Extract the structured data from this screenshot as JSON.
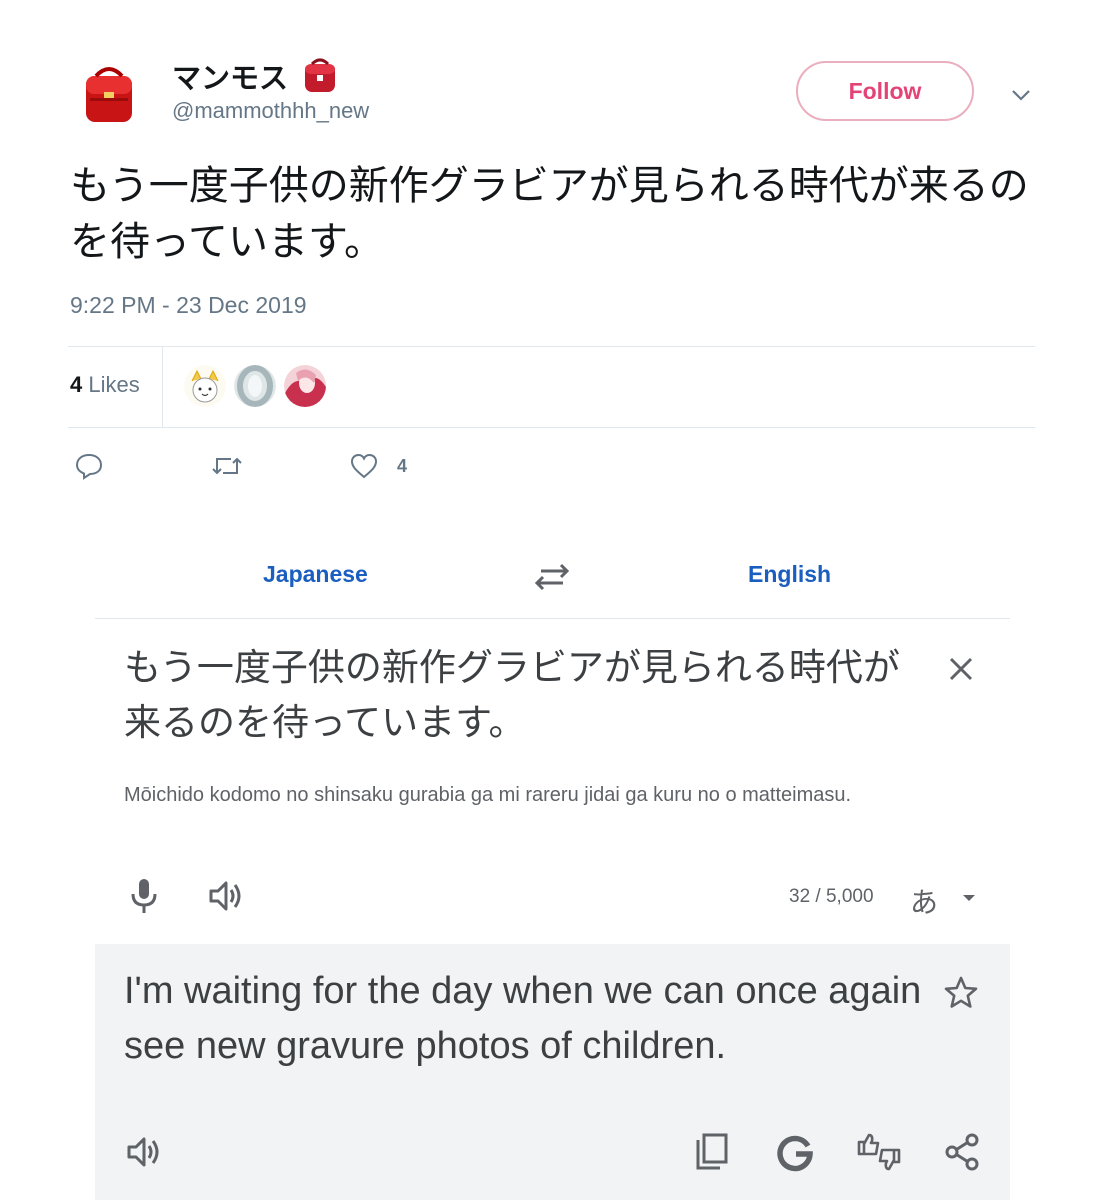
{
  "tweet": {
    "display_name": "マンモス",
    "handle": "@mammothhh_new",
    "follow_label": "Follow",
    "text": "もう一度子供の新作グラビアが見られる時代が来るのを待っています。",
    "timestamp": "9:22 PM - 23 Dec 2019",
    "likes_count": "4",
    "likes_label": "Likes",
    "like_action_count": "4"
  },
  "translate": {
    "source_language": "Japanese",
    "target_language": "English",
    "source_text": "もう一度子供の新作グラビアが見られる時代が来るのを待っています。",
    "romanization": "Mōichido kodomo no shinsaku gurabia ga mi rareru jidai ga kuru no o matteimasu.",
    "char_count": "32 / 5,000",
    "input_method_label": "あ",
    "translation": "I'm waiting for the day when we can once again see new gravure photos of children."
  },
  "colors": {
    "follow_border": "#e8a0b3",
    "follow_text": "#e0245e",
    "language_link": "#1a5ec0",
    "result_background": "#f1f3f4"
  },
  "icons": [
    "randoseru-avatar",
    "backpack-emoji",
    "chevron-down-icon",
    "reply-icon",
    "retweet-icon",
    "heart-icon",
    "swap-icon",
    "clear-icon",
    "mic-icon",
    "speaker-icon",
    "star-icon",
    "copy-icon",
    "google-icon",
    "feedback-icon",
    "share-icon"
  ]
}
